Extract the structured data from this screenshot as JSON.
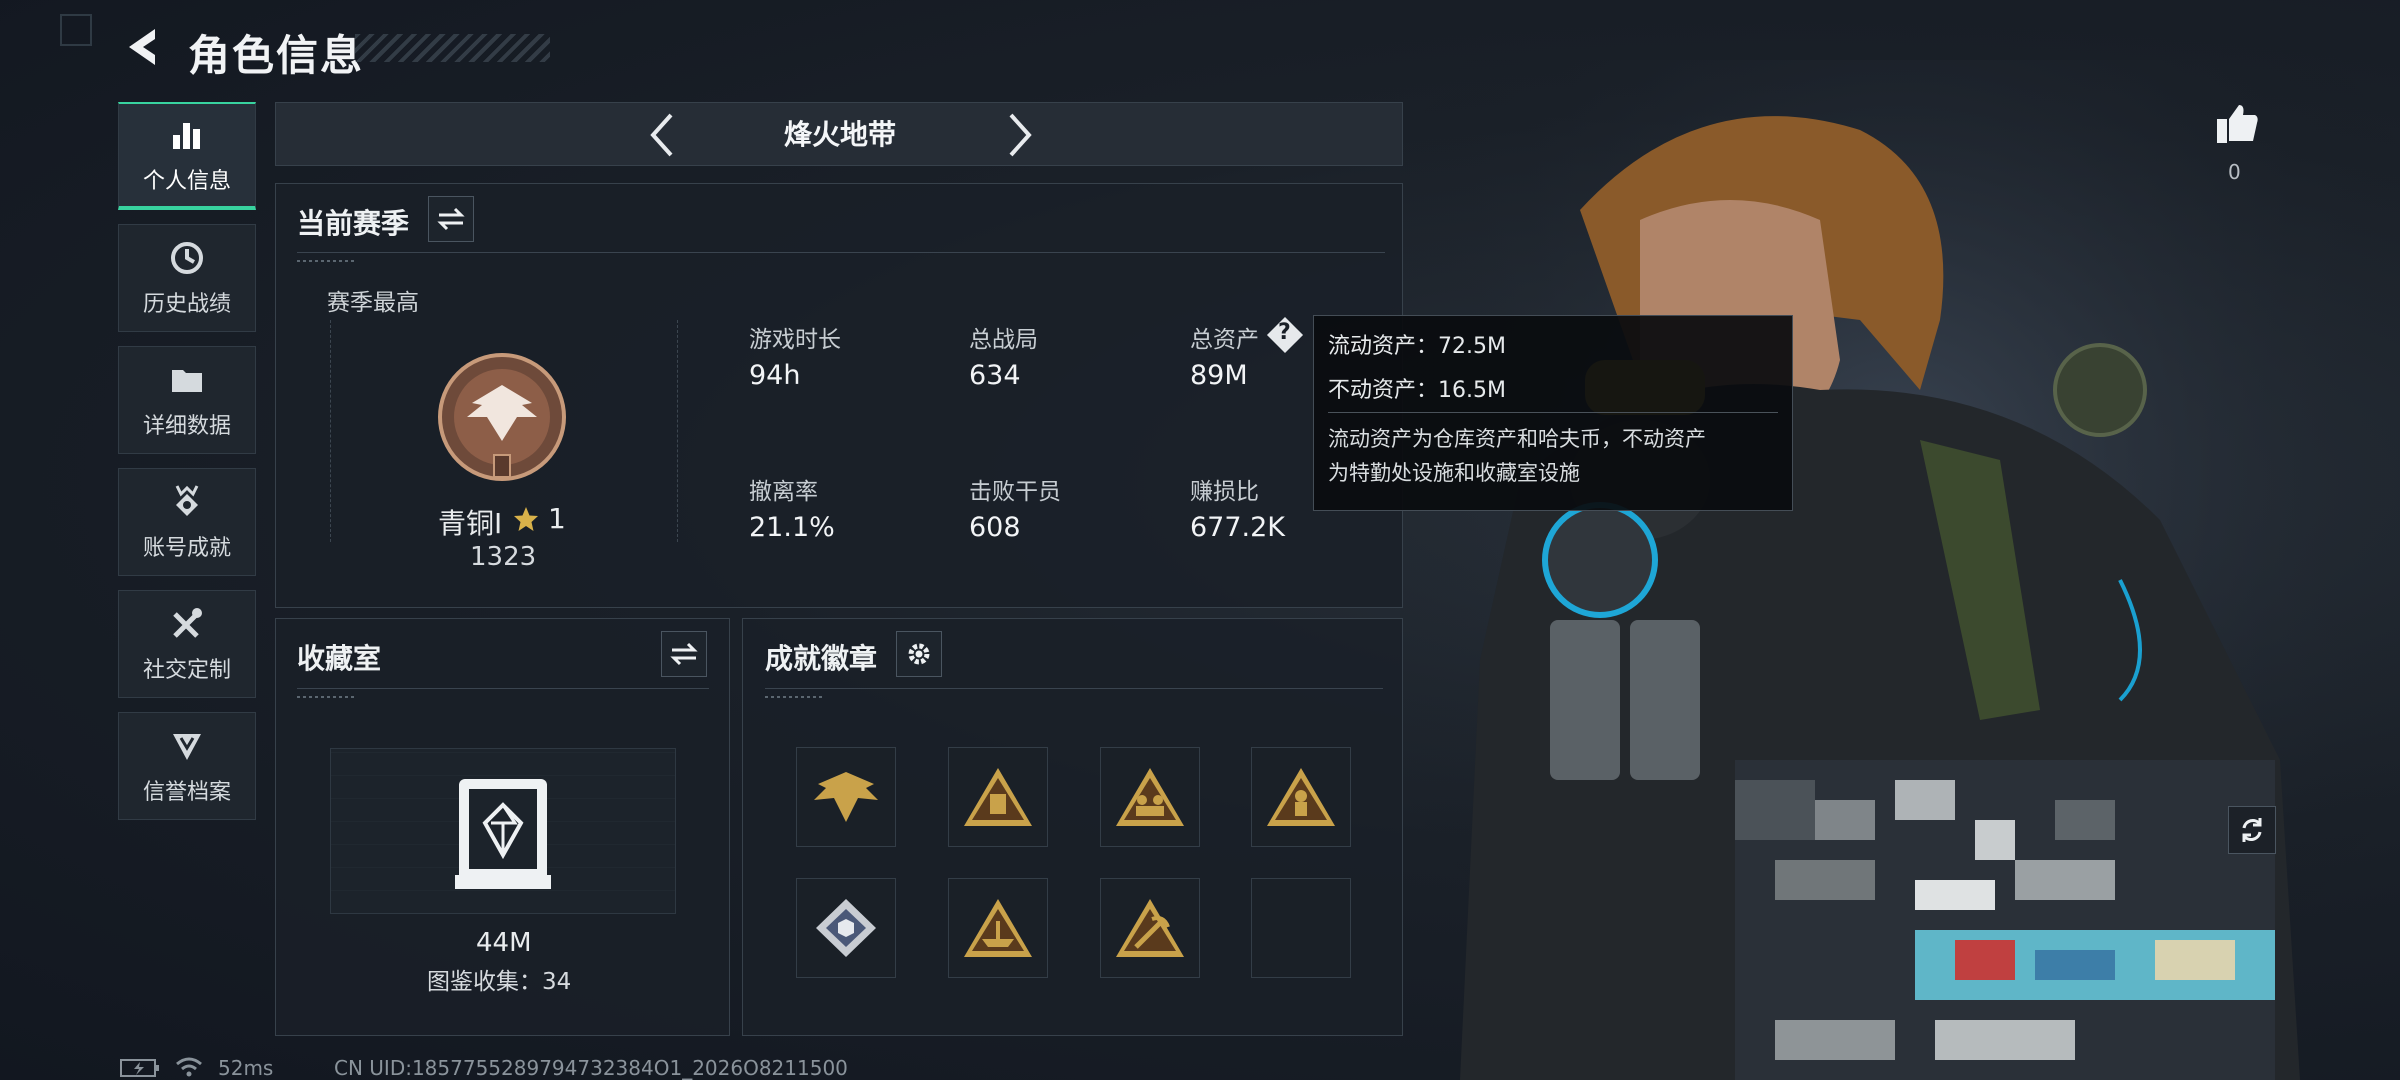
{
  "header": {
    "title": "角色信息"
  },
  "sidebar": {
    "items": [
      {
        "label": "个人信息",
        "icon": "bar-chart-icon",
        "active": true
      },
      {
        "label": "历史战绩",
        "icon": "clock-icon"
      },
      {
        "label": "详细数据",
        "icon": "folder-icon"
      },
      {
        "label": "账号成就",
        "icon": "medal-icon"
      },
      {
        "label": "社交定制",
        "icon": "tools-icon"
      },
      {
        "label": "信誉档案",
        "icon": "shield-icon"
      }
    ]
  },
  "mode": {
    "label": "烽火地带"
  },
  "season": {
    "title": "当前赛季",
    "best_label": "赛季最高",
    "rank_name": "青铜I",
    "rank_stars": "1",
    "rank_score": "1323",
    "stats": [
      {
        "label": "游戏时长",
        "value": "94h"
      },
      {
        "label": "总战局",
        "value": "634"
      },
      {
        "label": "总资产",
        "value": "89M"
      },
      {
        "label": "撤离率",
        "value": "21.1%"
      },
      {
        "label": "击败干员",
        "value": "608"
      },
      {
        "label": "赚损比",
        "value": "677.2K"
      }
    ]
  },
  "tooltip": {
    "liquid": "流动资产：72.5M",
    "fixed": "不动资产：16.5M",
    "desc_line1": "流动资产为仓库资产和哈夫币，不动资产",
    "desc_line2": "为特勤处设施和收藏室设施"
  },
  "collection": {
    "title": "收藏室",
    "value": "44M",
    "catalog": "图鉴收集：34"
  },
  "achievements": {
    "title": "成就徽章",
    "badges": [
      "eagle-badge-icon",
      "crate-badge-icon",
      "team-badge-icon",
      "soldier-badge-icon",
      "cube-badge-icon",
      "ship-badge-icon",
      "pickaxe-badge-icon",
      "empty-slot"
    ]
  },
  "like": {
    "count": "0"
  },
  "footer": {
    "ping": "52ms",
    "uid": "CN UID:1857755289794732384O1_2026O8211500"
  },
  "colors": {
    "accent": "#38d39f",
    "gold": "#c9a24a",
    "panel": "#1a2028"
  }
}
